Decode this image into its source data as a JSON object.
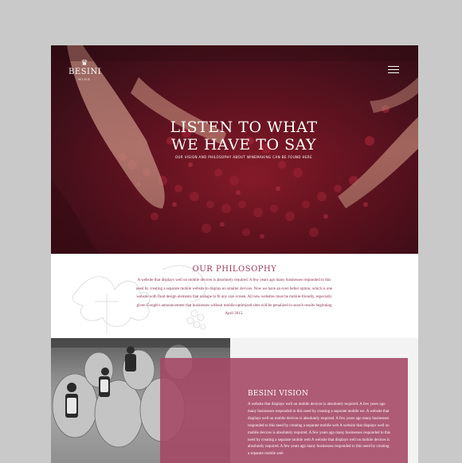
{
  "colors": {
    "accent": "#9a3a5a",
    "vision_panel": "#a44664",
    "hero_wine": "#6a1422",
    "frame": "#c9c9c9"
  },
  "header": {
    "logo": {
      "name": "BESINI",
      "tagline": "WINE"
    },
    "menu_icon": "hamburger-icon"
  },
  "hero": {
    "title_line1": "LISTEN TO WHAT",
    "title_line2": "WE HAVE TO SAY",
    "subtitle": "OUR VISION AND PHILOSOPHY ABOUT WINEMAKING CAN BE FOUND HERE"
  },
  "philosophy": {
    "title": "OUR PHILOSOPHY",
    "text": "A website that displays well on mobile devices is absolutely required. A few years ago many businesses responded to this need by creating a separate mobile website to display on smaller devices. Now we have an even better option, which is one website with fluid design elements that reshape to fit any size screen. All new websites must be mobile-friendly, especially given Google's announcement that businesses without mobile-optimized sites will be penalized in search results beginning April 2015."
  },
  "vision": {
    "title": "BESINI VISION",
    "text": "A website that displays well on mobile devices is absolutely required. A few years ago many businesses responded to this need by creating a separate mobile we. A website that displays well on mobile devices is absolutely required. A few years ago many businesses responded to this need by creating a separate mobile web A website that displays well on mobile devices is absolutely required. A few years ago many businesses responded to this need by creating a separate mobile web A website that displays well on mobile devices is absolutely required. A few years ago many businesses responded to this need by creating a separate mobile web"
  }
}
